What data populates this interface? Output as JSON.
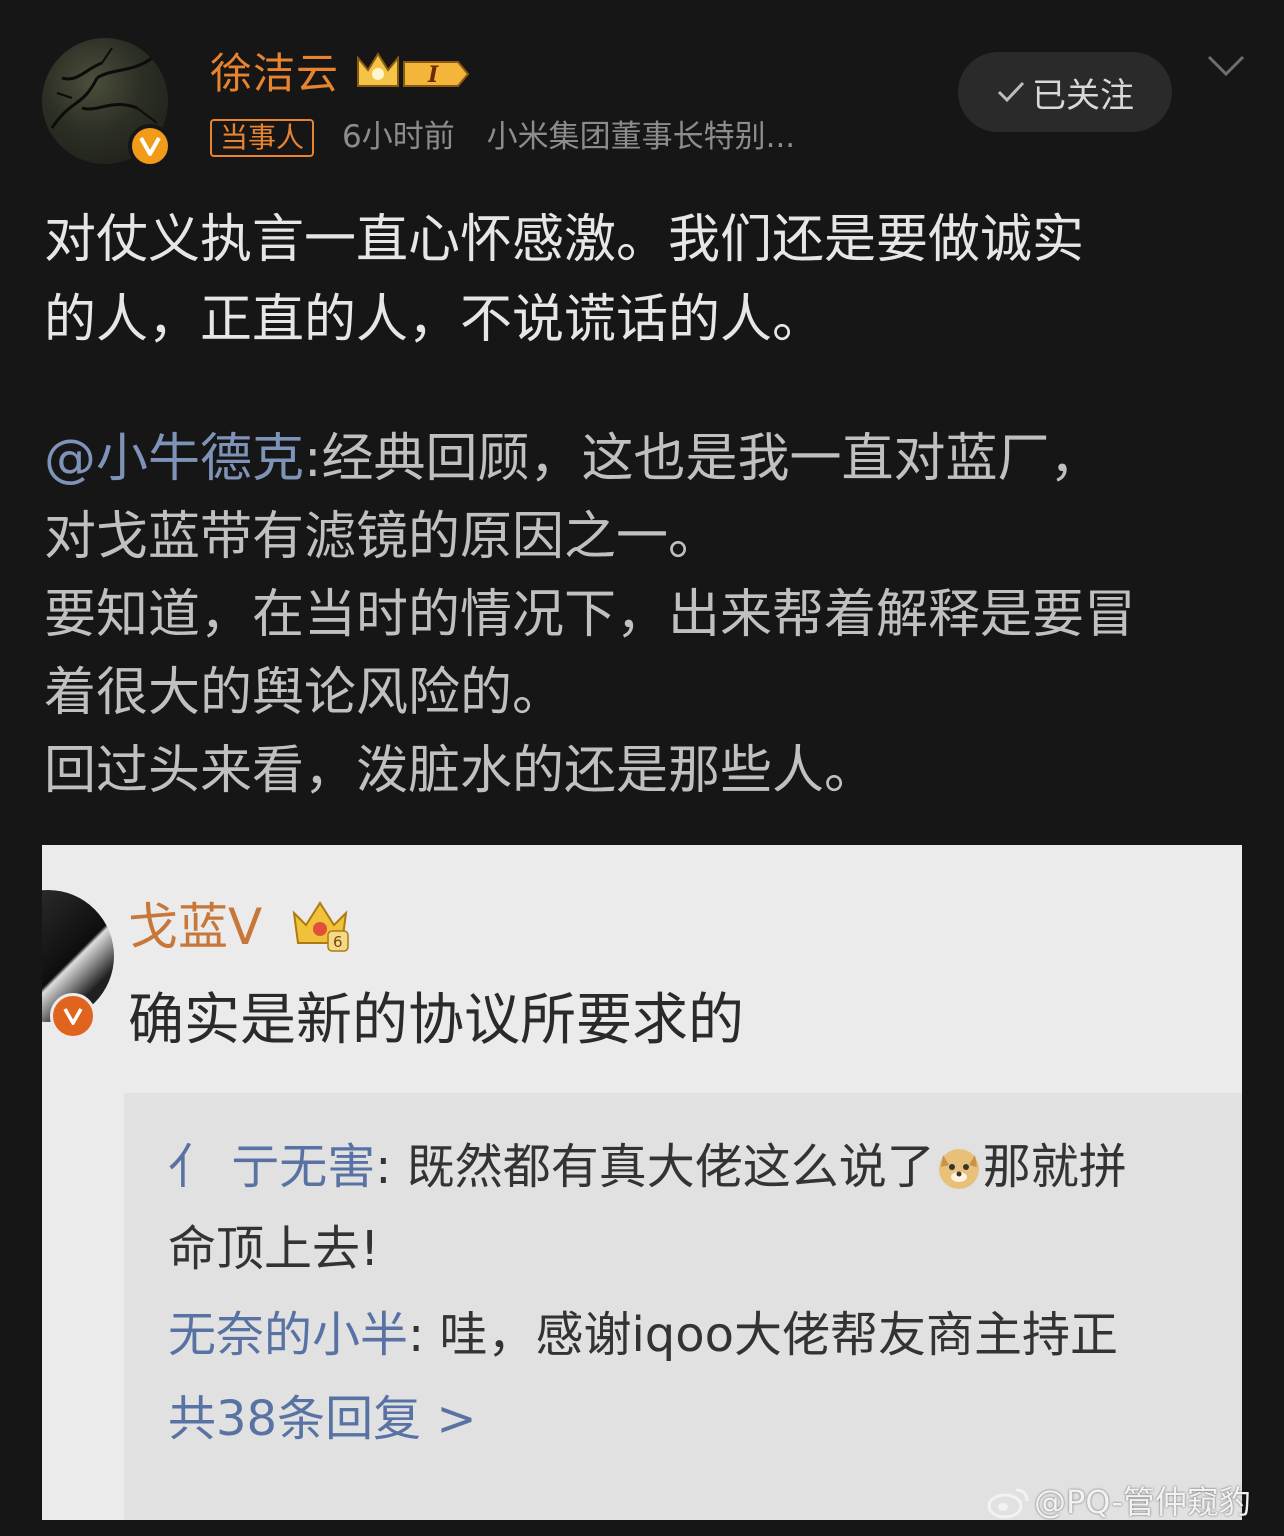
{
  "post": {
    "author_name": "徐洁云",
    "role_tag": "当事人",
    "time": "6小时前",
    "source": "小米集团董事长特别...",
    "follow_label": "已关注",
    "level_label": "I",
    "text_lines": [
      "对仗义执言一直心怀感激。我们还是要做诚实",
      "的人，正直的人，不说谎话的人。"
    ],
    "quote": {
      "mention": "@小牛德克",
      "line1_rest": ":经典回顾，这也是我一直对蓝厂，",
      "lines": [
        "对戈蓝带有滤镜的原因之一。",
        "要知道，在当时的情况下，出来帮着解释是要冒",
        "着很大的舆论风险的。",
        "回过头来看，泼脏水的还是那些人。"
      ]
    }
  },
  "embedded": {
    "name": "戈蓝V",
    "comment": "确实是新的协议所要求的",
    "crown_level": "6",
    "replies": [
      {
        "name": "亻 亍无害",
        "text": ": 既然都有真大佬这么说了",
        "text_after_emoji": "那就拼",
        "text_line2": "命顶上去!"
      },
      {
        "name": "无奈的小半",
        "text": ": 哇，感谢iqoo大佬帮友商主持正"
      }
    ],
    "reply_count": "共38条回复 >"
  },
  "watermark": "@PQ-管仲窥豹",
  "colors": {
    "background": "#161616",
    "accent_orange": "#e8832f",
    "mention_blue": "#7f93b8"
  }
}
